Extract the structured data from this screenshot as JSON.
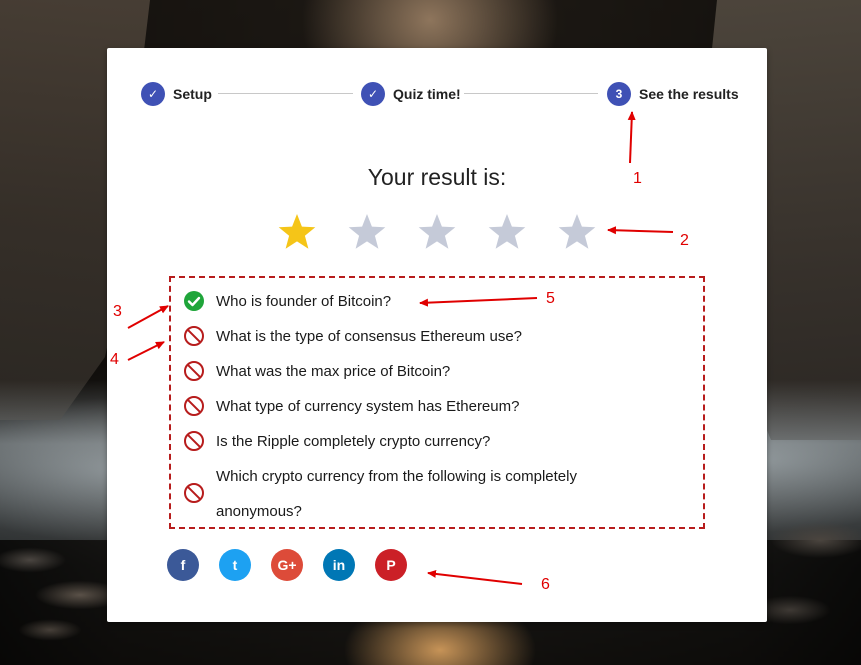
{
  "stepper": {
    "steps": [
      {
        "label": "Setup",
        "state": "done",
        "marker": "✓"
      },
      {
        "label": "Quiz time!",
        "state": "done",
        "marker": "✓"
      },
      {
        "label": "See the results",
        "state": "active",
        "marker": "3"
      }
    ]
  },
  "result": {
    "title": "Your result is:",
    "rating": 1,
    "max_rating": 5,
    "star_colors": {
      "filled": "#f5c518",
      "empty": "#c5cad8"
    }
  },
  "questions": [
    {
      "text": "Who is founder of Bitcoin?",
      "correct": true
    },
    {
      "text": "What is the type of consensus Ethereum use?",
      "correct": false
    },
    {
      "text": "What was the max price of Bitcoin?",
      "correct": false
    },
    {
      "text": "What type of currency system has Ethereum?",
      "correct": false
    },
    {
      "text": "Is the Ripple completely crypto currency?",
      "correct": false
    },
    {
      "text": "Which crypto currency from the following is completely anonymous?",
      "correct": false
    }
  ],
  "social": [
    {
      "name": "facebook",
      "glyph": "f",
      "color": "#3b5998"
    },
    {
      "name": "twitter",
      "glyph": "t",
      "color": "#1da1f2"
    },
    {
      "name": "google-plus",
      "glyph": "G+",
      "color": "#dd4b39"
    },
    {
      "name": "linkedin",
      "glyph": "in",
      "color": "#0077b5"
    },
    {
      "name": "pinterest",
      "glyph": "P",
      "color": "#cb2027"
    }
  ],
  "annotations": [
    "1",
    "2",
    "3",
    "4",
    "5",
    "6"
  ],
  "colors": {
    "accent": "#3f51b5",
    "correct": "#1fa53a",
    "wrong": "#b71c1c",
    "annotation": "#e00000"
  }
}
